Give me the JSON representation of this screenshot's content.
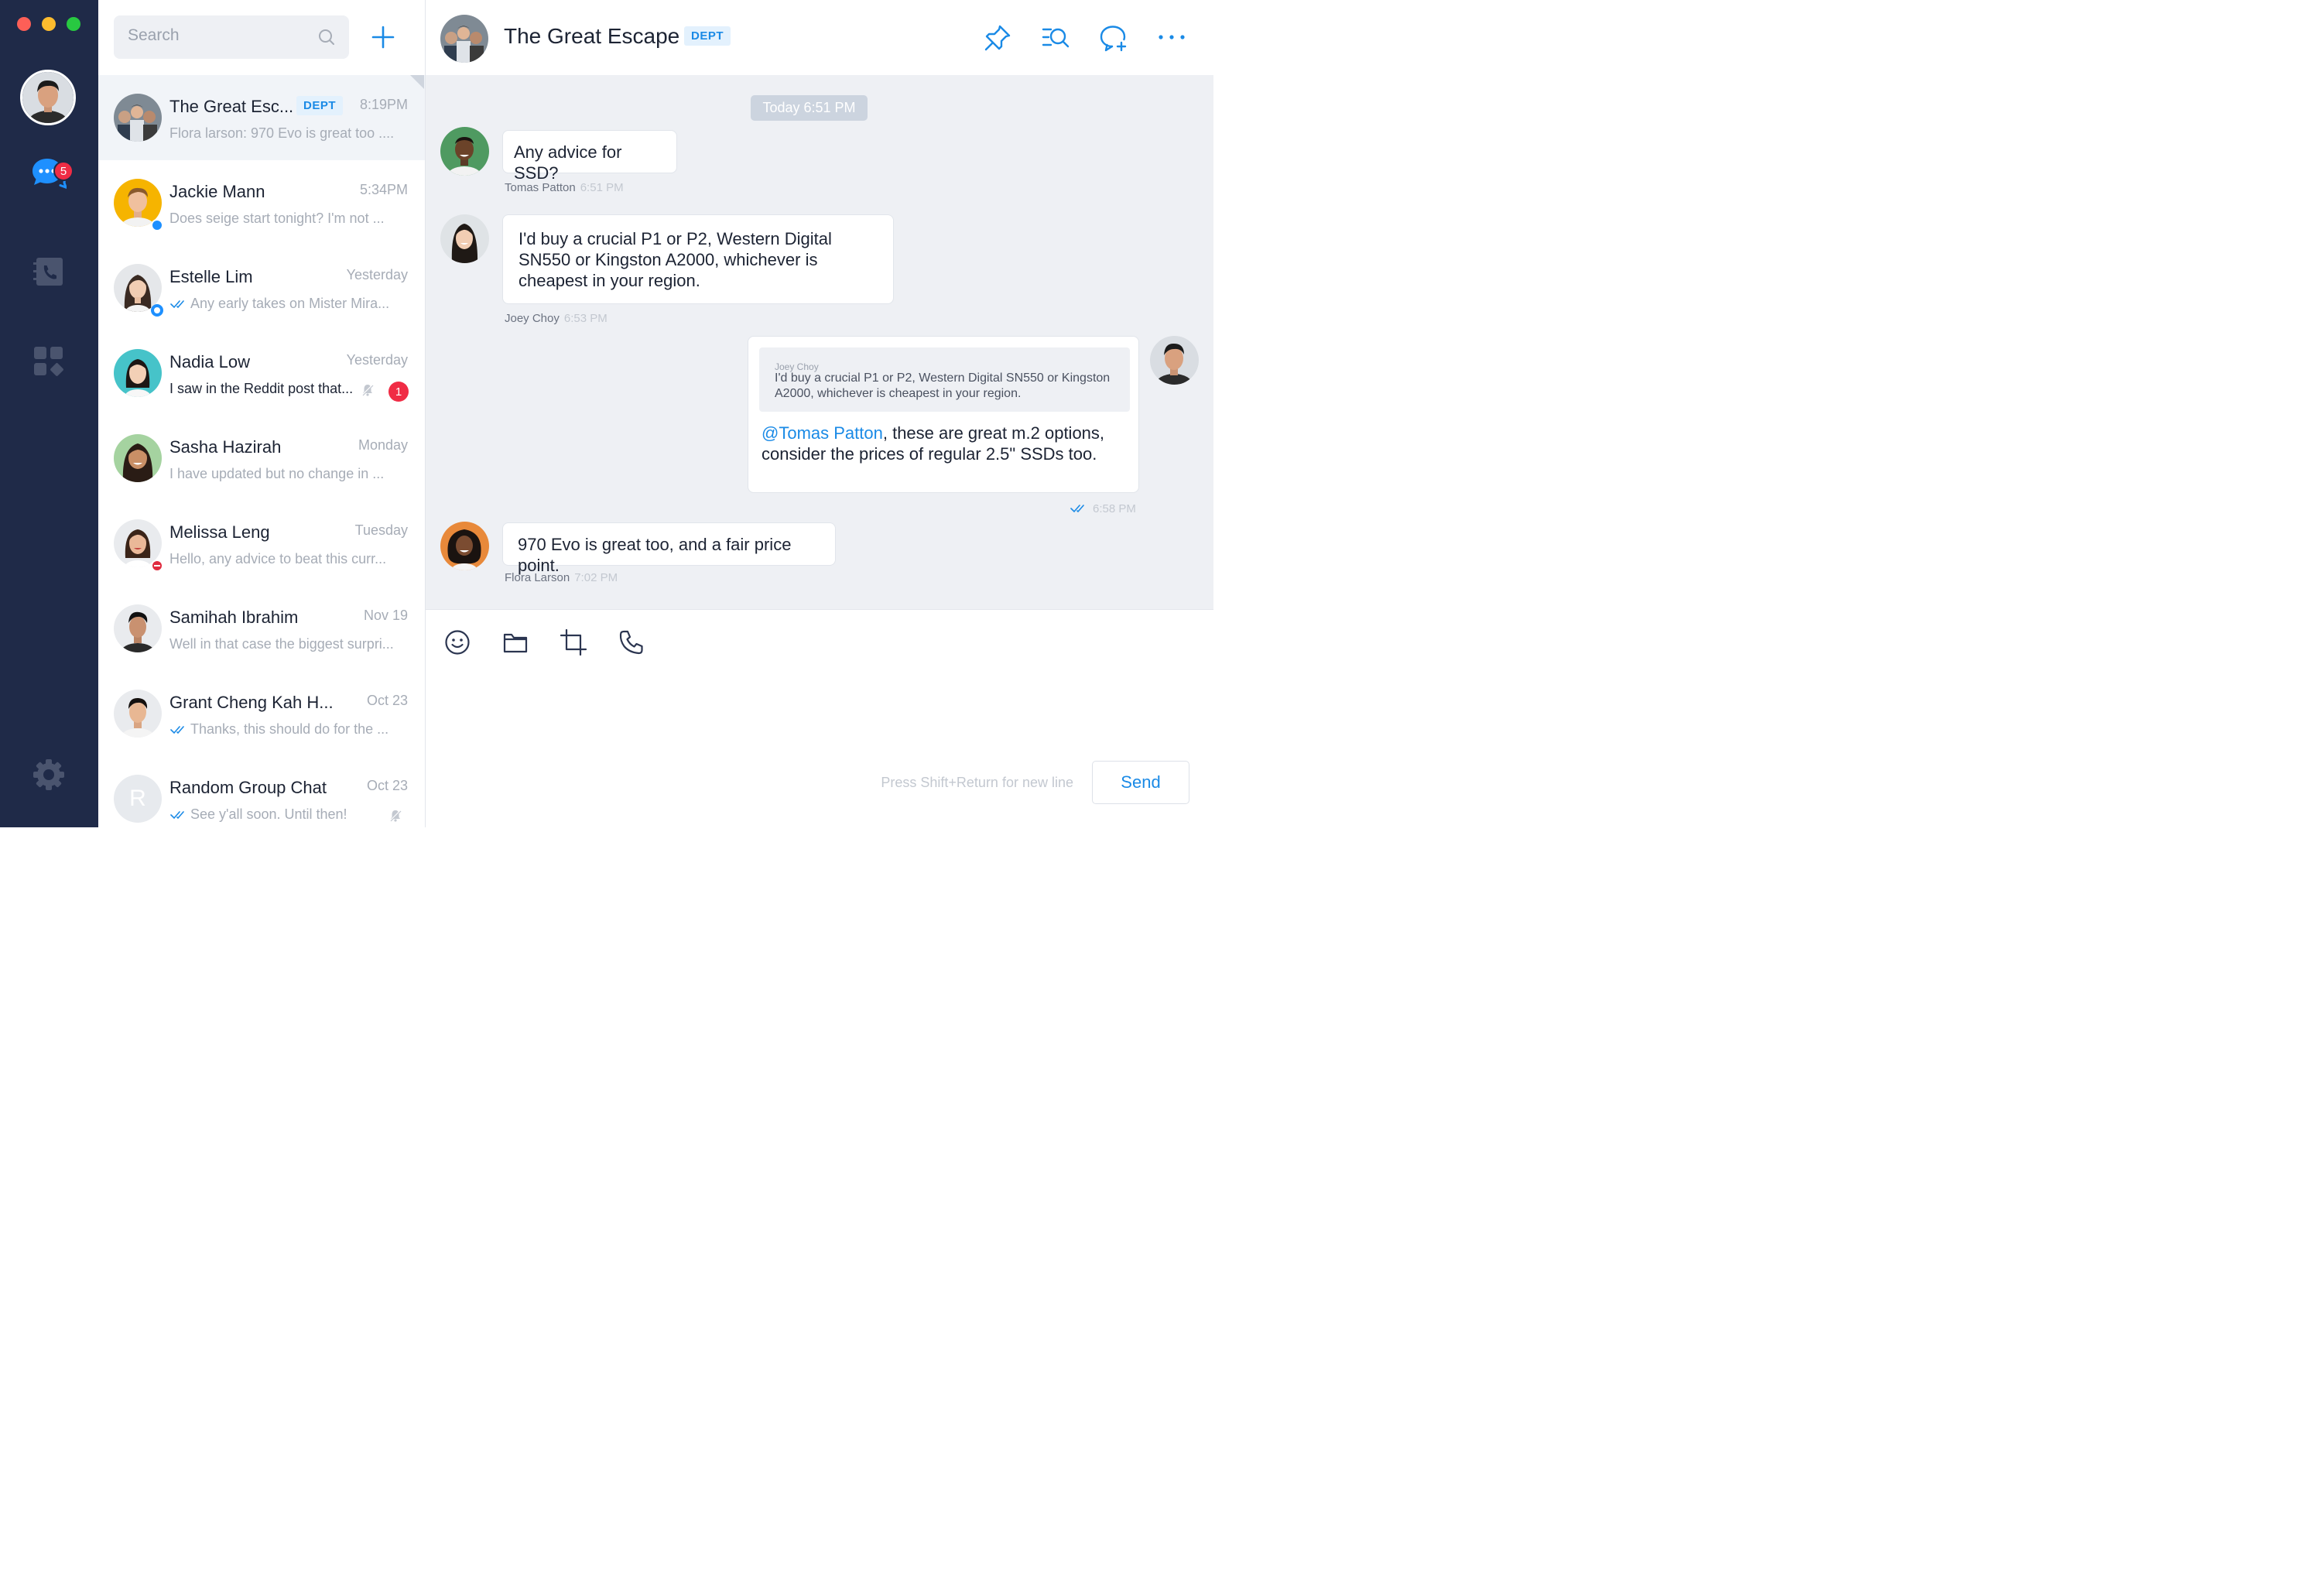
{
  "window": {
    "traffic_lights": [
      "close",
      "minimize",
      "zoom"
    ],
    "colors": {
      "close": "#fd5f57",
      "minimize": "#fdbc2e",
      "zoom": "#28c941"
    }
  },
  "sidebar": {
    "unread_badge": "5",
    "items": [
      "chat-icon",
      "contacts-icon",
      "apps-icon",
      "settings-icon"
    ]
  },
  "conversations": {
    "search_placeholder": "Search",
    "items": [
      {
        "name": "The Great Esc...",
        "tag": "DEPT",
        "time": "8:19PM",
        "preview": "Flora larson: 970 Evo is great too ...."
      },
      {
        "name": "Jackie Mann",
        "time": "5:34PM",
        "preview": "Does seige start tonight? I'm not ..."
      },
      {
        "name": "Estelle Lim",
        "time": "Yesterday",
        "preview": "Any early takes on Mister Mira..."
      },
      {
        "name": "Nadia Low",
        "time": "Yesterday",
        "preview": "I saw in the Reddit post that...",
        "unread": "1"
      },
      {
        "name": "Sasha Hazirah",
        "time": "Monday",
        "preview": "I have updated but no change in ..."
      },
      {
        "name": "Melissa Leng",
        "time": "Tuesday",
        "preview": "Hello, any advice to beat this curr..."
      },
      {
        "name": "Samihah Ibrahim",
        "time": "Nov 19",
        "preview": "Well in that case the biggest surpri..."
      },
      {
        "name": "Grant Cheng Kah H...",
        "time": "Oct 23",
        "preview": "Thanks, this should do for the ..."
      },
      {
        "name": "Random Group Chat",
        "initial": "R",
        "time": "Oct 23",
        "preview": "See y'all soon. Until then!"
      }
    ]
  },
  "chat": {
    "title": "The Great Escape",
    "tag": "DEPT",
    "day_divider": "Today  6:51 PM",
    "messages": [
      {
        "author": "Tomas Patton",
        "time": "6:51 PM",
        "text": "Any advice for SSD?"
      },
      {
        "author": "Joey Choy",
        "time": "6:53 PM",
        "text": "I'd buy a crucial P1 or P2, Western Digital SN550 or Kingston A2000, whichever is cheapest in your region."
      },
      {
        "quote_author": "Joey Choy",
        "quote_text": "I'd buy a crucial P1 or P2, Western Digital SN550 or Kingston A2000, whichever is cheapest in your region.",
        "mention": "@Tomas Patton",
        "text": ", these are great m.2 options, consider the prices of regular 2.5\" SSDs too.",
        "time": "6:58 PM"
      },
      {
        "author": "Flora Larson",
        "time": "7:02 PM",
        "text": "970 Evo is great too, and a fair price point."
      }
    ]
  },
  "composer": {
    "hint": "Press Shift+Return for new line",
    "send_label": "Send"
  },
  "colors": {
    "accent": "#1a8ae6",
    "rail": "#1f2a48",
    "badge": "#f02c45"
  }
}
